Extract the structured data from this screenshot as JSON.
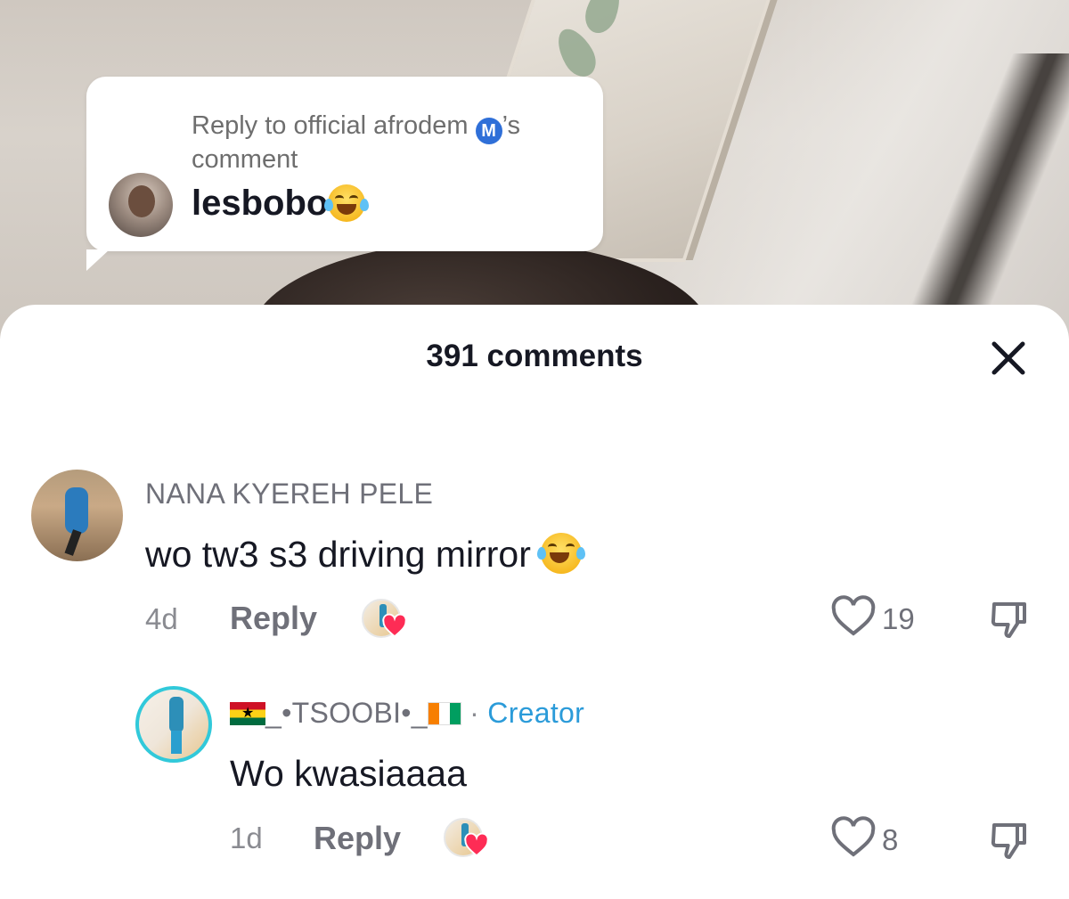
{
  "video": {
    "reply_bubble": {
      "header_prefix": "Reply to official afrodem",
      "badge_letter": "M",
      "header_suffix": "’s",
      "header_line2": "comment",
      "text": "lesbobo",
      "emoji": "face-with-tears-of-joy"
    }
  },
  "sheet": {
    "title": "391 comments",
    "close_icon": "close-icon"
  },
  "comments": [
    {
      "username": "NANA KYEREH PELE",
      "text": "wo tw3 s3 driving mirror",
      "emoji": "face-with-tears-of-joy",
      "age": "4d",
      "reply_label": "Reply",
      "likes": "19",
      "liked_by_creator": true
    },
    {
      "username_prefix": "_•TSOOBI•_",
      "flags": [
        "ghana-flag",
        "ivory-coast-flag"
      ],
      "separator": "·",
      "badge": "Creator",
      "text": "Wo kwasiaaaa",
      "age": "1d",
      "reply_label": "Reply",
      "likes": "8",
      "liked_by_creator": true
    }
  ],
  "colors": {
    "creator_badge": "#2b9bd9",
    "creator_ring": "#31c9da",
    "heart": "#fe2c55"
  }
}
